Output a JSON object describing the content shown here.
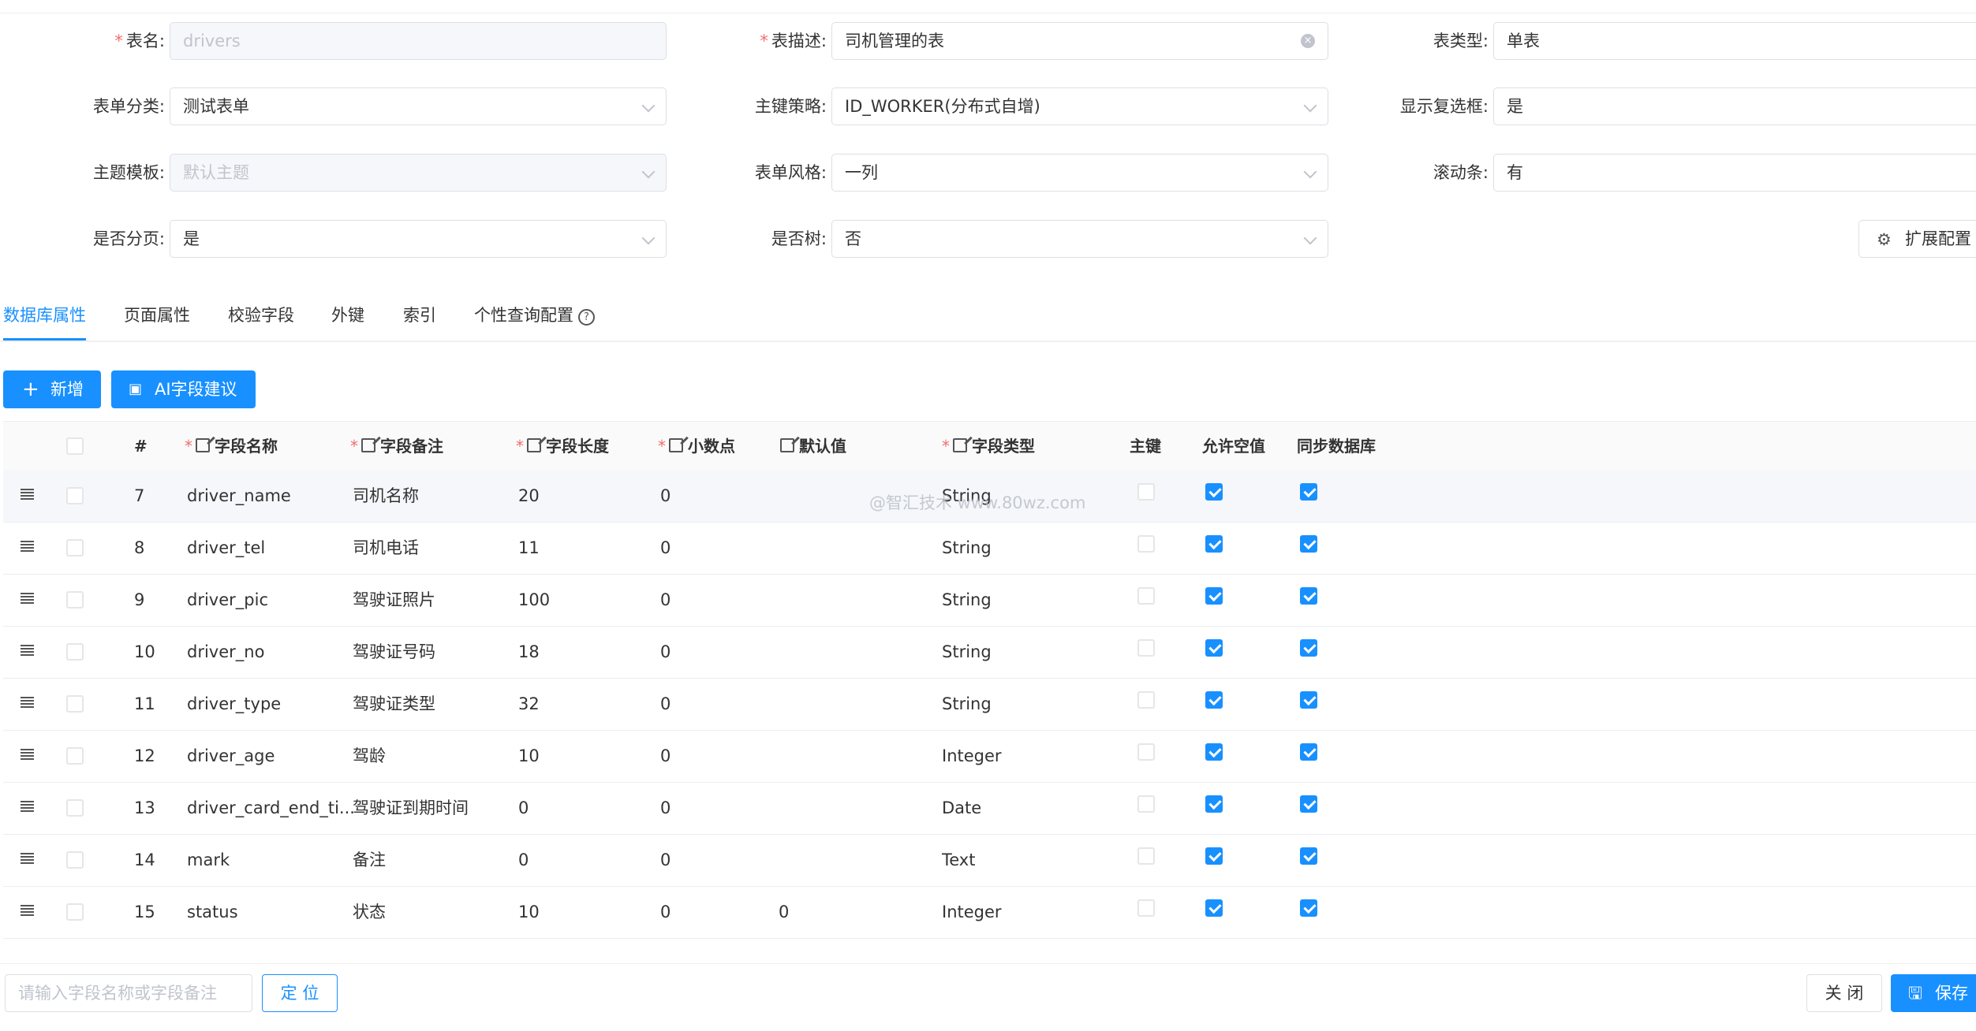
{
  "form": {
    "table_name_label": "表名:",
    "table_name_value": "drivers",
    "table_desc_label": "表描述:",
    "table_desc_value": "司机管理的表",
    "table_type_label": "表类型:",
    "table_type_value": "单表",
    "form_category_label": "表单分类:",
    "form_category_value": "测试表单",
    "pk_strategy_label": "主键策略:",
    "pk_strategy_value": "ID_WORKER(分布式自增)",
    "show_checkbox_label": "显示复选框:",
    "show_checkbox_value": "是",
    "theme_label": "主题模板:",
    "theme_value": "默认主题",
    "form_style_label": "表单风格:",
    "form_style_value": "一列",
    "scrollbar_label": "滚动条:",
    "scrollbar_value": "有",
    "paging_label": "是否分页:",
    "paging_value": "是",
    "is_tree_label": "是否树:",
    "is_tree_value": "否",
    "ext_config_label": "扩展配置"
  },
  "tabs": [
    "数据库属性",
    "页面属性",
    "校验字段",
    "外键",
    "索引",
    "个性查询配置"
  ],
  "toolbar": {
    "add_label": "新增",
    "ai_label": "AI字段建议"
  },
  "table": {
    "headers": {
      "index": "#",
      "field_name": "字段名称",
      "field_comment": "字段备注",
      "field_length": "字段长度",
      "decimal": "小数点",
      "default_value": "默认值",
      "field_type": "字段类型",
      "primary_key": "主键",
      "nullable": "允许空值",
      "sync_db": "同步数据库"
    },
    "rows": [
      {
        "index": "7",
        "name": "driver_name",
        "comment": "司机名称",
        "length": "20",
        "decimal": "0",
        "default": "",
        "type": "String",
        "pk": false,
        "nullable": true,
        "sync": true
      },
      {
        "index": "8",
        "name": "driver_tel",
        "comment": "司机电话",
        "length": "11",
        "decimal": "0",
        "default": "",
        "type": "String",
        "pk": false,
        "nullable": true,
        "sync": true
      },
      {
        "index": "9",
        "name": "driver_pic",
        "comment": "驾驶证照片",
        "length": "100",
        "decimal": "0",
        "default": "",
        "type": "String",
        "pk": false,
        "nullable": true,
        "sync": true
      },
      {
        "index": "10",
        "name": "driver_no",
        "comment": "驾驶证号码",
        "length": "18",
        "decimal": "0",
        "default": "",
        "type": "String",
        "pk": false,
        "nullable": true,
        "sync": true
      },
      {
        "index": "11",
        "name": "driver_type",
        "comment": "驾驶证类型",
        "length": "32",
        "decimal": "0",
        "default": "",
        "type": "String",
        "pk": false,
        "nullable": true,
        "sync": true
      },
      {
        "index": "12",
        "name": "driver_age",
        "comment": "驾龄",
        "length": "10",
        "decimal": "0",
        "default": "",
        "type": "Integer",
        "pk": false,
        "nullable": true,
        "sync": true
      },
      {
        "index": "13",
        "name": "driver_card_end_ti...",
        "comment": "驾驶证到期时间",
        "length": "0",
        "decimal": "0",
        "default": "",
        "type": "Date",
        "pk": false,
        "nullable": true,
        "sync": true
      },
      {
        "index": "14",
        "name": "mark",
        "comment": "备注",
        "length": "0",
        "decimal": "0",
        "default": "",
        "type": "Text",
        "pk": false,
        "nullable": true,
        "sync": true
      },
      {
        "index": "15",
        "name": "status",
        "comment": "状态",
        "length": "10",
        "decimal": "0",
        "default": "0",
        "type": "Integer",
        "pk": false,
        "nullable": true,
        "sync": true
      }
    ]
  },
  "watermark": "@智汇技术 www.80wz.com",
  "footer": {
    "search_placeholder": "请输入字段名称或字段备注",
    "locate_label": "定 位",
    "close_label": "关 闭",
    "save_label": "保存"
  }
}
